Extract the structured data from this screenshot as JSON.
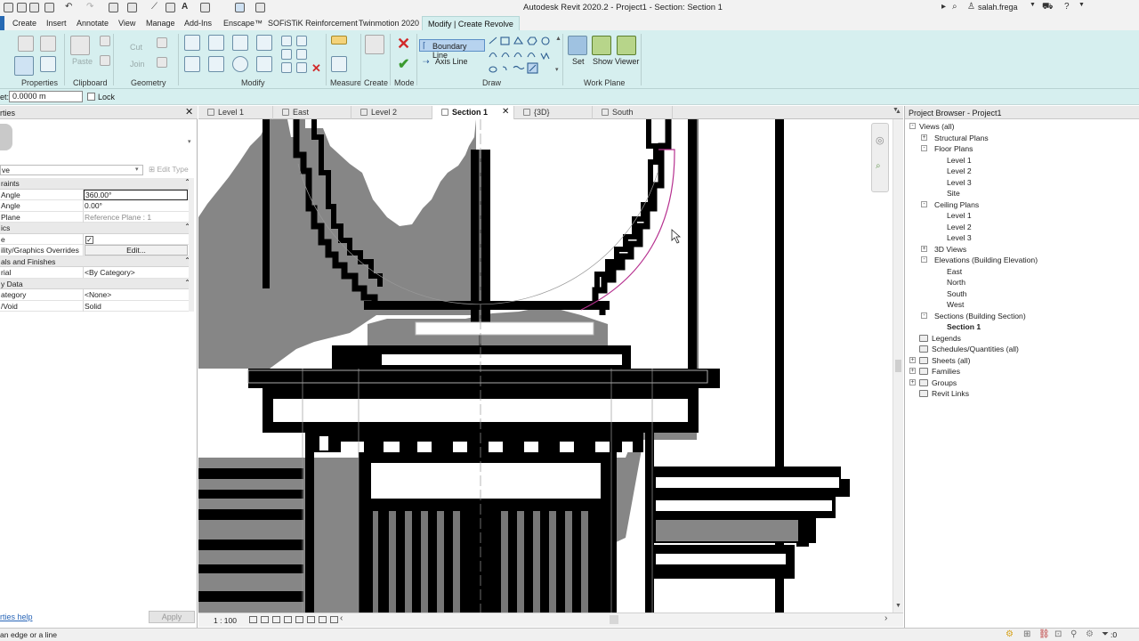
{
  "window": {
    "title": "Autodesk Revit 2020.2 - Project1 - Section: Section 1",
    "user": "salah.frega"
  },
  "ribbon_tabs": [
    "Create",
    "Insert",
    "Annotate",
    "View",
    "Manage",
    "Add-Ins",
    "Enscape™",
    "SOFiSTiK Reinforcement",
    "Twinmotion 2020",
    "Modify | Create Revolve"
  ],
  "ribbon": {
    "panels": [
      "Properties",
      "Clipboard",
      "Geometry",
      "Modify",
      "Measure",
      "Create",
      "Mode",
      "Draw",
      "Work Plane"
    ],
    "clipboard": {
      "paste": "Paste",
      "cut": "Cut",
      "join": "Join"
    },
    "draw": {
      "boundary_line": "Boundary Line",
      "axis_line": "Axis Line"
    },
    "work_plane": {
      "set": "Set",
      "show": "Show",
      "viewer": "Viewer"
    }
  },
  "options_bar": {
    "offset_label": "et:",
    "offset_value": "0.0000 m",
    "lock_label": "Lock"
  },
  "properties": {
    "header": "rties",
    "type_selector": "ve",
    "edit_type": "Edit Type",
    "rows": [
      {
        "kind": "group",
        "label": "raints"
      },
      {
        "kind": "row",
        "key": "Angle",
        "value": "360.00°"
      },
      {
        "kind": "row",
        "key": "Angle",
        "value": "0.00°"
      },
      {
        "kind": "row",
        "key": "Plane",
        "value": "Reference Plane : 1"
      },
      {
        "kind": "group",
        "label": "ics"
      },
      {
        "kind": "row",
        "key": "e",
        "value": ""
      },
      {
        "kind": "row",
        "key": "ility/Graphics Overrides",
        "value": "Edit..."
      },
      {
        "kind": "group",
        "label": "als and Finishes"
      },
      {
        "kind": "row",
        "key": "rial",
        "value": "<By Category>"
      },
      {
        "kind": "group",
        "label": "y Data"
      },
      {
        "kind": "row",
        "key": "ategory",
        "value": "<None>"
      },
      {
        "kind": "row",
        "key": "/Void",
        "value": "Solid"
      }
    ],
    "help_link": "rties help",
    "apply": "Apply"
  },
  "view_tabs": [
    {
      "label": "Level 1",
      "active": false
    },
    {
      "label": "East",
      "active": false
    },
    {
      "label": "Level 2",
      "active": false
    },
    {
      "label": "Section 1",
      "active": true
    },
    {
      "label": "{3D}",
      "active": false
    },
    {
      "label": "South",
      "active": false
    }
  ],
  "view_control": {
    "scale": "1 : 100"
  },
  "project_browser": {
    "title": "Project Browser - Project1",
    "tree": [
      {
        "label": "Views (all)",
        "level": 0,
        "exp": "-"
      },
      {
        "label": "Structural Plans",
        "level": 1,
        "exp": "+"
      },
      {
        "label": "Floor Plans",
        "level": 1,
        "exp": "-"
      },
      {
        "label": "Level 1",
        "level": 2
      },
      {
        "label": "Level 2",
        "level": 2
      },
      {
        "label": "Level 3",
        "level": 2
      },
      {
        "label": "Site",
        "level": 2
      },
      {
        "label": "Ceiling Plans",
        "level": 1,
        "exp": "-"
      },
      {
        "label": "Level 1",
        "level": 2
      },
      {
        "label": "Level 2",
        "level": 2
      },
      {
        "label": "Level 3",
        "level": 2
      },
      {
        "label": "3D Views",
        "level": 1,
        "exp": "+"
      },
      {
        "label": "Elevations (Building Elevation)",
        "level": 1,
        "exp": "-"
      },
      {
        "label": "East",
        "level": 2
      },
      {
        "label": "North",
        "level": 2
      },
      {
        "label": "South",
        "level": 2
      },
      {
        "label": "West",
        "level": 2
      },
      {
        "label": "Sections (Building Section)",
        "level": 1,
        "exp": "-"
      },
      {
        "label": "Section 1",
        "level": 2,
        "bold": true
      },
      {
        "label": "Legends",
        "level": 0,
        "icon": true
      },
      {
        "label": "Schedules/Quantities (all)",
        "level": 0,
        "icon": true
      },
      {
        "label": "Sheets (all)",
        "level": 0,
        "exp": "+",
        "icon": true
      },
      {
        "label": "Families",
        "level": 0,
        "exp": "+",
        "icon": true
      },
      {
        "label": "Groups",
        "level": 0,
        "exp": "+",
        "icon": true
      },
      {
        "label": "Revit Links",
        "level": 0,
        "icon": true
      }
    ]
  },
  "status": {
    "text": "an edge or a line",
    "count": ":0"
  }
}
